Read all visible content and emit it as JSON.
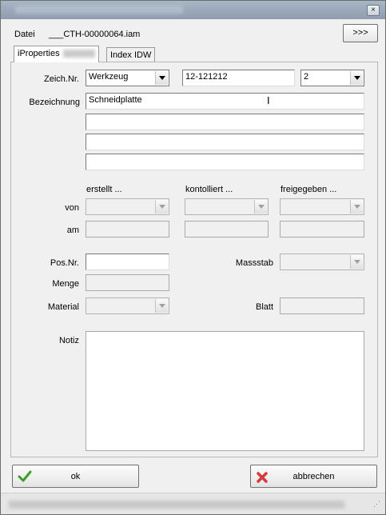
{
  "window": {
    "close_glyph": "×"
  },
  "header": {
    "datei_label": "Datei",
    "file_name": "___CTH-00000064.iam",
    "more_label": ">>>"
  },
  "tabs": [
    {
      "label": "iProperties"
    },
    {
      "label": "Index IDW"
    }
  ],
  "form": {
    "zeich_label": "Zeich.Nr.",
    "zeich_type": "Werkzeug",
    "zeich_number": "12-121212",
    "zeich_index": "2",
    "bezeichnung_label": "Bezeichnung",
    "bezeichnung_lines": [
      "Schneidplatte",
      "",
      "",
      ""
    ],
    "col_erstellt": "erstellt ...",
    "col_kontrolliert": "kontolliert ...",
    "col_freigegeben": "freigegeben ...",
    "von_label": "von",
    "am_label": "am",
    "posnr_label": "Pos.Nr.",
    "posnr_value": "",
    "massstab_label": "Massstab",
    "menge_label": "Menge",
    "material_label": "Material",
    "blatt_label": "Blatt",
    "notiz_label": "Notiz"
  },
  "footer": {
    "ok_label": "ok",
    "cancel_label": "abbrechen"
  },
  "colors": {
    "ok_check": "#3ca02a",
    "cancel_x": "#d33a3a"
  }
}
